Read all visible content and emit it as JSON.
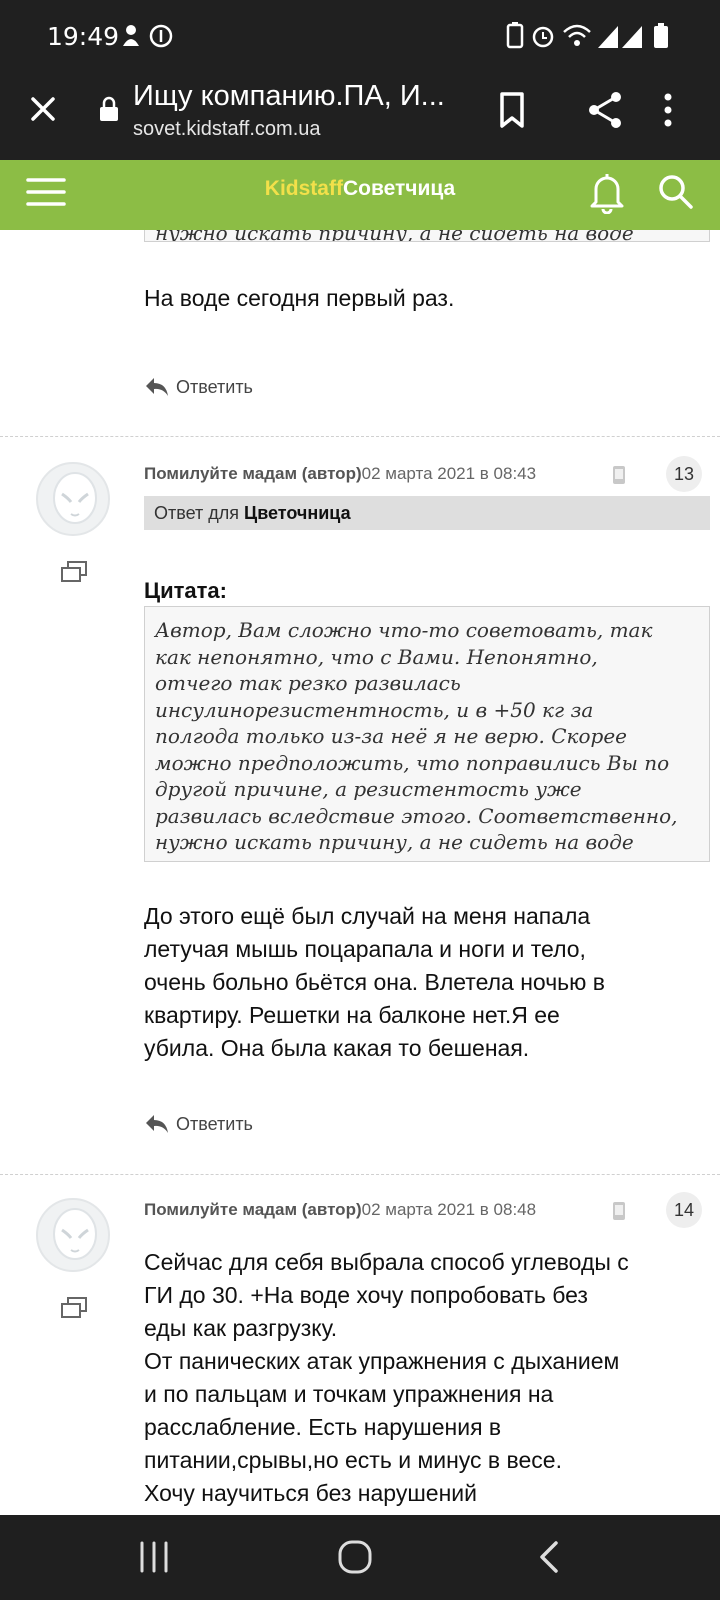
{
  "status_bar": {
    "time": "19:49"
  },
  "browser": {
    "tab_title": "Ищу компанию.ПА, И...",
    "url": "sovet.kidstaff.com.ua"
  },
  "site_header": {
    "logo_part1": "Kidstaff",
    "logo_part2": "Советчица"
  },
  "prev_post": {
    "quote_tail": "нужно искать причину, а не сидеть на воде",
    "text": "На воде сегодня первый раз.",
    "reply_label": "Ответить"
  },
  "posts": [
    {
      "author": "Помилуйте мадам (автор)",
      "date": "02 марта 2021 в 08:43",
      "number": "13",
      "reply_to_label": "Ответ для",
      "reply_to_name": "Цветочница",
      "quote_label": "Цитата:",
      "quote_lines": [
        "Автор, Вам сложно что-то советовать, так",
        "как непонятно, что с Вами. Непонятно,",
        "отчего так резко развилась",
        "инсулинорезистентность, и в +50 кг за",
        "полгода только из-за неё я не верю. Скорее",
        "можно предположить, что поправились Вы по",
        "другой причине, а резистентость уже",
        "развилась вследствие этого. Соответственно,",
        "нужно искать причину, а не сидеть на воде"
      ],
      "text_lines": [
        "До этого ещё был случай на меня напала",
        "летучая мышь поцарапала и ноги и тело,",
        "очень больно бьётся она. Влетела ночью в",
        "квартиру. Решетки на балконе нет.Я ее",
        "убила. Она была какая то бешеная."
      ],
      "reply_label": "Ответить"
    },
    {
      "author": "Помилуйте мадам (автор)",
      "date": "02 марта 2021 в 08:48",
      "number": "14",
      "text_lines": [
        "Сейчас для себя выбрала способ углеводы с",
        "ГИ до 30. +На воде хочу попробовать без",
        "еды как разгрузку.",
        "От панических атак упражнения с дыханием",
        "и по пальцам и точкам упражнения на",
        "расслабление. Есть нарушения в",
        "питании,срывы,но есть и минус в весе.",
        "Хочу научиться без нарушений"
      ]
    }
  ],
  "colors": {
    "header_green": "#8cbd45",
    "logo_yellow": "#f2e04a",
    "chrome_dark": "#202020"
  }
}
